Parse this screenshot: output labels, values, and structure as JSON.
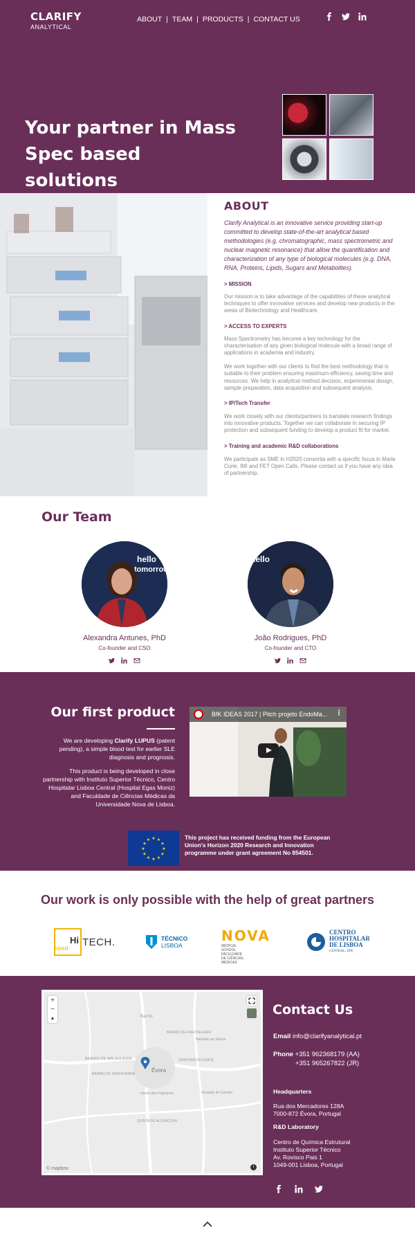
{
  "header": {
    "logo_line1": "CLARIFY",
    "logo_line2": "ANALYTICAL",
    "nav": [
      "ABOUT",
      "TEAM",
      "PRODUCTS",
      "CONTACT US"
    ],
    "nav_sep": "|",
    "social_icons": [
      "facebook-icon",
      "twitter-icon",
      "linkedin-icon"
    ]
  },
  "hero": {
    "title": "Your partner in Mass Spec based solutions"
  },
  "about": {
    "title": "ABOUT",
    "intro": "Clarify Analytical is an innovative service providing start-up committed to develop state-of-the-art analytical based methodologies (e.g. chromatographic, mass spectrometric and nuclear magnetic resonance) that allow the quantification and characterization of any type of biological molecules (e.g. DNA, RNA, Proteins, Lipids, Sugars and Metabolites).",
    "mission_h": "> MISSION",
    "mission_p": "Our mission is to take advantage of the capabilities of these analytical techniques to offer innovative services and develop new products in the areas of Biotechnology and Healthcare.",
    "experts_h": "> ACCESS TO EXPERTS",
    "experts_p1": "Mass Spectrometry has become a key technology for the characterisation of any given biological molecule with a broad range of applications in academia and industry.",
    "experts_p2": "We work together with our clients to find the best methodology that is suitable to their problem ensuring maximum efficiency, saving time and resources. We help in analytical method decision, experimental design, sample preparation, data acquisition and subsequent analysis.",
    "ip_h": "> IP/Tech Transfer",
    "ip_p": "We work closely with our clients/partners to translate research findings into innovative products. Together we can collaborate in securing IP protection and subsequent funding to develop a product fit for market.",
    "training_h": "> Training and academic R&D collaborations",
    "training_p": "We participate as SME in H2020 consortia with a specific focus in Marie Curie, IMI and FET Open Calls. Please contact us if you have any idea of partnership."
  },
  "team": {
    "title": "Our Team",
    "members": [
      {
        "name": "Alexandra Antunes, PhD",
        "role": "Co-founder and CSO"
      },
      {
        "name": "João Rodrigues, PhD",
        "role": "Co-founder and CTO"
      }
    ],
    "avatar_backdrop_1": "hello",
    "avatar_backdrop_2": "tomorrow"
  },
  "product": {
    "title": "Our first product",
    "p1_pre": "We are developing ",
    "p1_bold": "Clarify LUPUS",
    "p1_post": " (patent pending), a simple blood test for earlier SLE diagnosis and prognosis.",
    "p2": "This product is being developed in close partnership with Instituto Superior Técnico, Centro Hospitalar Lisboa Central (Hospital Egas Moniz) and Faculdade de Ciências Médicas da Universidade Nova de Lisboa.",
    "video_title": "BfK IDEAS 2017 | Pitch projeto EndoMa...",
    "eu_text": "This project has received funding from the European Union's Horizon 2020 Research and Innovation programme under grant agreement No 854501."
  },
  "partners": {
    "title": "Our work is only possible with the help of great partners",
    "hiseed_a": "Hi",
    "hiseed_b": "seed",
    "hiseed_c": "TECH.",
    "tecnico_a": "TÉCNICO",
    "tecnico_b": "LISBOA",
    "nova_a": "NOVA",
    "nova_b": "MEDICAL",
    "nova_c": "SCHOOL",
    "nova_d": "FACULDADE",
    "nova_e": "DE CIÊNCIAS",
    "nova_f": "MÉDICAS",
    "chlc_a": "CENTRO",
    "chlc_b": "HOSPITALAR",
    "chlc_c": "DE LISBOA",
    "chlc_d": "CENTRAL, EPE"
  },
  "contact": {
    "title": "Contact Us",
    "email_label": "Email",
    "email": "info@clarifyanalytical.pt",
    "phone_label": "Phone",
    "phone1": "+351 962368179 (AA)",
    "phone2": "+351 965267822 (JR)",
    "hq_label": "Headquarters",
    "hq_line1": "Rua dos Mercadores 128A",
    "hq_line2": "7000-872 Évora, Portugal",
    "lab_label": "R&D Laboratory",
    "lab_line1": "Centro de Química Estrutural",
    "lab_line2": "Instituto Superior Técnico",
    "lab_line3": "Av. Rovisco Pais 1",
    "lab_line4": "1049-001 Lisboa, Portugal",
    "map_city": "Évora",
    "map_places": [
      "Barrôs",
      "BAIRRO DE MALAGUEIRA",
      "BAIRRO DE FRECHELEIRO",
      "Ramalho de Seixas",
      "SENHORA DA SAÚDE",
      "BAIRRO DE SANTA MARIA",
      "Horta das Figueiras",
      "Herdade do Canhão",
      "QUINTA DE ALCARCOVA"
    ],
    "map_zoom_in": "+",
    "map_zoom_out": "−",
    "map_credit": "© mapbox"
  },
  "colors": {
    "brand": "#6a2f59",
    "eu_blue": "#0f3a94",
    "eu_yellow": "#ffdd00"
  }
}
